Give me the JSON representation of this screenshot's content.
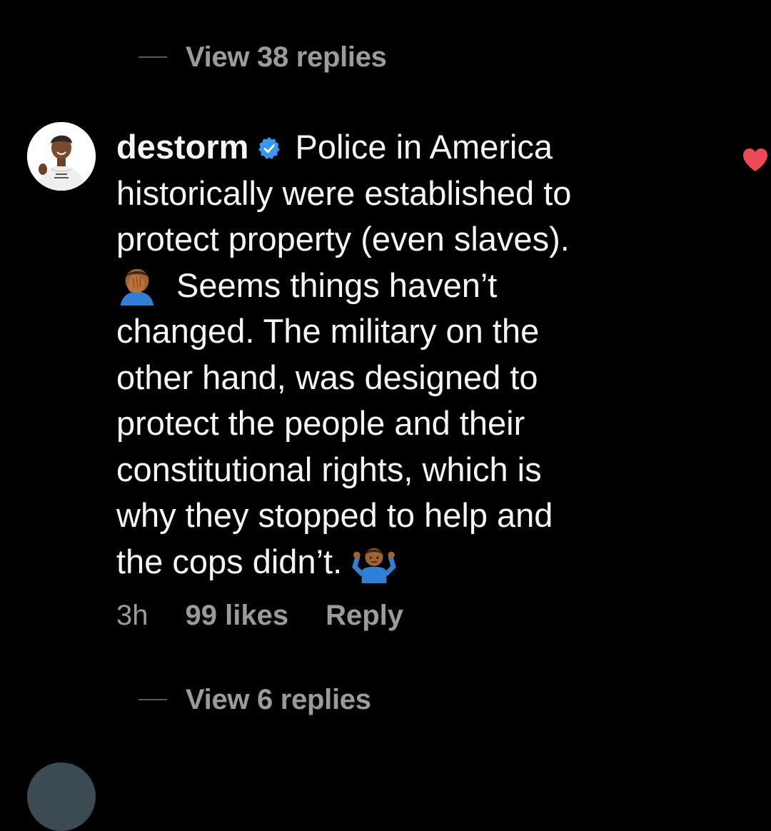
{
  "top_replies": {
    "label": "View 38 replies"
  },
  "comment": {
    "username": "destorm",
    "verified": true,
    "lines": [
      "Police in America",
      "historically were established to",
      "protect property (even slaves).",
      "Seems things haven’t",
      "changed. The military on the",
      "other hand, was designed to",
      "protect the people and their",
      "constitutional rights, which is",
      "why they stopped to help and",
      "the cops didn’t."
    ],
    "emojis": [
      "man-facepalming-emoji",
      "man-shrugging-emoji"
    ],
    "liked": true
  },
  "meta": {
    "time": "3h",
    "likes": "99 likes",
    "reply": "Reply"
  },
  "bottom_replies": {
    "label": "View 6 replies"
  },
  "colors": {
    "background": "#000000",
    "text": "#f5f5f5",
    "muted": "#9b9b9b",
    "heart": "#ed4956",
    "verified": "#3897f0"
  }
}
